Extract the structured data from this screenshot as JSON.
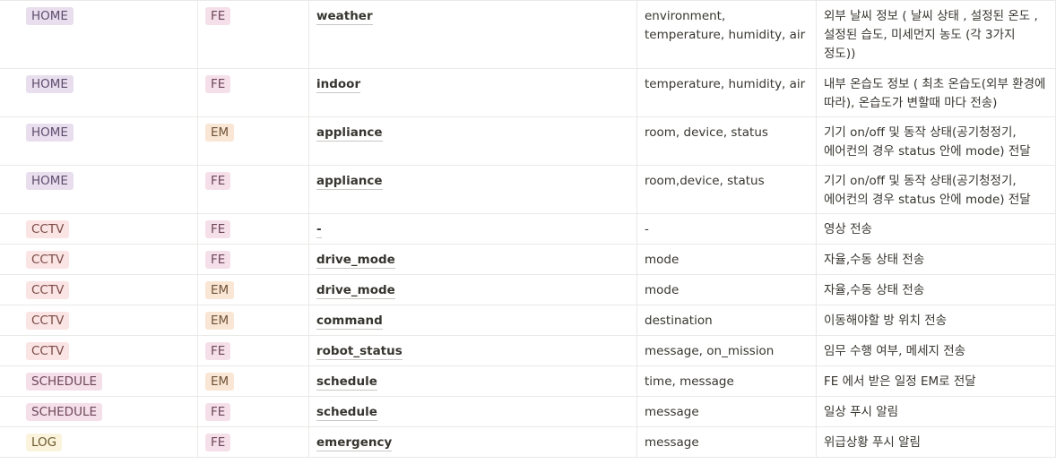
{
  "colors": {
    "HOME": {
      "bg": "#e8deee",
      "fg": "#5e4f6e"
    },
    "CCTV": {
      "bg": "#fbe4e4",
      "fg": "#7a4a46"
    },
    "SCHEDULE": {
      "bg": "#f5e0e9",
      "fg": "#6e4657"
    },
    "LOG": {
      "bg": "#fbf3db",
      "fg": "#6b5a2e"
    },
    "FE": {
      "bg": "#f5e0e9",
      "fg": "#6e4657"
    },
    "EM": {
      "bg": "#fae6d4",
      "fg": "#6f5238"
    }
  },
  "rows": [
    {
      "category": "HOME",
      "target": "FE",
      "topic": "weather",
      "fields": "environment, temperature, humidity, air",
      "description": "외부 날씨 정보 ( 날씨 상태 , 설정된 온도 , 설정된 습도,  미세먼지 농도 (각 3가지 정도))"
    },
    {
      "category": "HOME",
      "target": "FE",
      "topic": "indoor",
      "fields": "temperature, humidity, air",
      "description": "내부 온습도 정보 ( 최초 온습도(외부 환경에 따라), 온습도가 변할때 마다 전송)"
    },
    {
      "category": "HOME",
      "target": "EM",
      "topic": "appliance",
      "fields": "room, device, status",
      "description": "기기 on/off 및 동작 상태(공기청정기, 에어컨의 경우 status 안에 mode) 전달"
    },
    {
      "category": "HOME",
      "target": "FE",
      "topic": "appliance",
      "fields": "room,device, status",
      "description": "기기 on/off 및 동작 상태(공기청정기, 에어컨의 경우 status 안에 mode) 전달"
    },
    {
      "category": "CCTV",
      "target": "FE",
      "topic": "-",
      "fields": "-",
      "description": "영상 전송"
    },
    {
      "category": "CCTV",
      "target": "FE",
      "topic": "drive_mode",
      "fields": "mode",
      "description": "자율,수동 상태 전송"
    },
    {
      "category": "CCTV",
      "target": "EM",
      "topic": "drive_mode",
      "fields": "mode",
      "description": "자율,수동 상태 전송"
    },
    {
      "category": "CCTV",
      "target": "EM",
      "topic": "command",
      "fields": "destination",
      "description": "이동해야할 방 위치 전송"
    },
    {
      "category": "CCTV",
      "target": "FE",
      "topic": "robot_status",
      "fields": "message, on_mission",
      "description": "임무 수행 여부, 메세지 전송"
    },
    {
      "category": "SCHEDULE",
      "target": "EM",
      "topic": "schedule",
      "fields": "time, message",
      "description": "FE 에서 받은 일정 EM로 전달"
    },
    {
      "category": "SCHEDULE",
      "target": "FE",
      "topic": "schedule",
      "fields": "message",
      "description": "일상 푸시 알림"
    },
    {
      "category": "LOG",
      "target": "FE",
      "topic": "emergency",
      "fields": "message",
      "description": "위급상황 푸시 알림"
    }
  ]
}
